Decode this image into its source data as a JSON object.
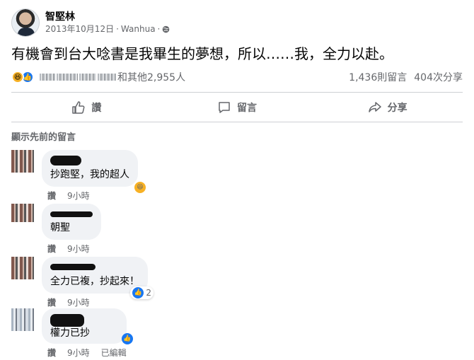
{
  "post": {
    "author": "智堅林",
    "date": "2013年10月12日",
    "separator": "·",
    "location": "Wanhua",
    "globe_icon": "globe-icon",
    "text": "有機會到台大唸書是我畢生的夢想，所以……我，全力以赴。",
    "reactions_text": "和其他2,955人",
    "comments_count": "1,436則留言",
    "shares_count": "404次分享"
  },
  "actions": {
    "like": "讚",
    "comment": "留言",
    "share": "分享"
  },
  "comments_section": {
    "show_previous": "顯示先前的留言"
  },
  "comments": [
    {
      "text": "抄跑堅，我的超人",
      "like_label": "讚",
      "time": "9小時",
      "reaction": "haha",
      "reaction_count": ""
    },
    {
      "text": "朝聖",
      "like_label": "讚",
      "time": "9小時",
      "reaction": "",
      "reaction_count": ""
    },
    {
      "text": "全力已複，抄起來！",
      "like_label": "讚",
      "time": "9小時",
      "reaction": "like",
      "reaction_count": "2"
    },
    {
      "text": "權力已抄",
      "like_label": "讚",
      "time": "9小時",
      "edited": "已編輯",
      "reaction": "like",
      "reaction_count": ""
    }
  ],
  "colors": {
    "link_blue": "#1877f2",
    "haha_yellow": "#f7b125",
    "meta_gray": "#65676b",
    "bubble_bg": "#f0f2f5"
  }
}
